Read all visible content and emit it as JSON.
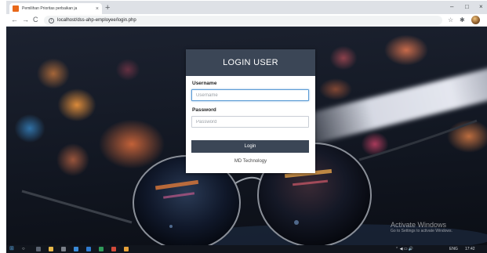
{
  "browser": {
    "tab_title": "Pemilihan Prioritas perbaikan ja",
    "tab_close": "×",
    "new_tab": "+",
    "url": "localhost/dss-ahp-employee/login.php",
    "nav_back": "←",
    "nav_forward": "→",
    "nav_reload": "C",
    "info": "i",
    "bookmark_star": "☆",
    "extensions": "✱",
    "minimize": "–",
    "restore": "□",
    "close": "×"
  },
  "login": {
    "title": "LOGIN USER",
    "username_label": "Username",
    "username_placeholder": "Username",
    "password_label": "Password",
    "password_placeholder": "Password",
    "login_button": "Login",
    "footer": "MD Technology"
  },
  "watermark": {
    "title": "Activate Windows",
    "subtitle": "Go to Settings to activate Windows."
  },
  "taskbar": {
    "start": "⊞",
    "search": "○",
    "tray_icons": "⌃ ◀ ▭ 🔊",
    "language": "ENG",
    "time": "17:42"
  },
  "colors": {
    "card_header": "#3b4656",
    "login_button": "#3b4656",
    "focus_border": "#5b9bd5",
    "favicon": "#e8681a"
  }
}
